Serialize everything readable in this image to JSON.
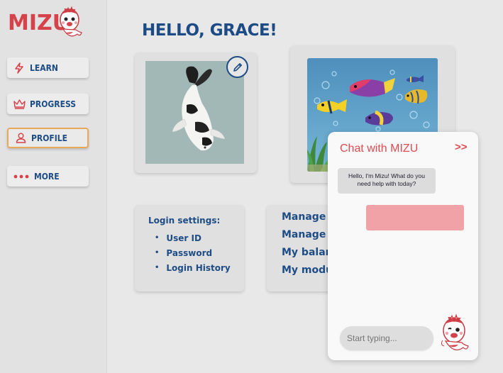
{
  "app": {
    "logo": "MIZU"
  },
  "sidebar": {
    "items": [
      {
        "label": "LEARN",
        "icon": "lightning-icon"
      },
      {
        "label": "PROGRESS",
        "icon": "crown-icon"
      },
      {
        "label": "PROFILE",
        "icon": "user-icon",
        "active": true
      },
      {
        "label": "MORE",
        "icon": "dots-icon"
      }
    ]
  },
  "main": {
    "greeting": "HELLO, GRACE!",
    "login": {
      "title": "Login settings:",
      "items": [
        "User ID",
        "Password",
        "Login History"
      ]
    },
    "manage": {
      "items": [
        "Manage ba",
        "Manage ca",
        "My balanc",
        "My modul"
      ]
    }
  },
  "chat": {
    "title": "Chat with MIZU",
    "close_label": ">>",
    "bot_message": "Hello, I'm Mizu! What do you need help with today?",
    "input_placeholder": "Start typing..."
  },
  "colors": {
    "brand_red": "#d6424a",
    "navy": "#1e4d86",
    "active_border": "#e8a95a",
    "user_bubble": "#f0a2a6"
  }
}
